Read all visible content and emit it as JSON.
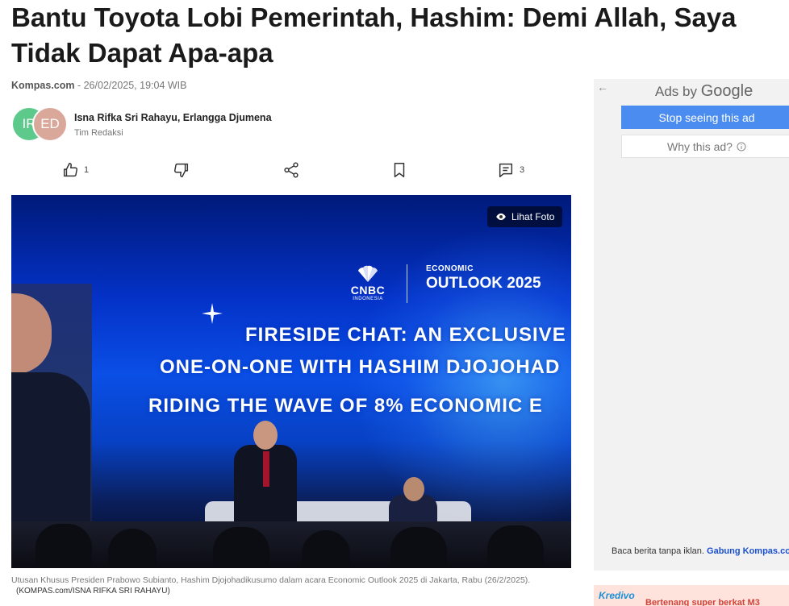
{
  "article": {
    "headline": "Bantu Toyota Lobi Pemerintah, Hashim: Demi Allah, Saya Tidak Dapat Apa-apa",
    "source": "Kompas.com",
    "separator": " - ",
    "date": "26/02/2025, 19:04 WIB",
    "authors": {
      "avatar1": "IR",
      "avatar2": "ED",
      "names": "Isna Rifka Sri Rahayu, Erlangga Djumena",
      "role": "Tim Redaksi"
    }
  },
  "actions": {
    "like_count": "1",
    "comment_count": "3"
  },
  "photo": {
    "lihat_foto": "Lihat Foto",
    "cnbc": "CNBC",
    "cnbc_sub": "INDONESIA",
    "econ_small": "ECONOMIC",
    "econ_big": "OUTLOOK 2025",
    "line1": "FIRESIDE CHAT: AN EXCLUSIVE",
    "line2": "ONE-ON-ONE WITH HASHIM DJOJOHAD",
    "line3": "RIDING THE WAVE OF 8% ECONOMIC E",
    "caption": "Utusan Khusus Presiden Prabowo Subianto, Hashim Djojohadikusumo dalam acara Economic Outlook 2025 di Jakarta, Rabu (26/2/2025).",
    "credit": "(KOMPAS.com/ISNA RIFKA SRI RAHAYU)"
  },
  "ad": {
    "back_icon": "arrow-left-icon",
    "ads_by": "Ads by ",
    "google": "Google",
    "stop": "Stop seeing this ad",
    "why": "Why this ad?",
    "noad_text": "Baca berita tanpa iklan. ",
    "noad_link": "Gabung Kompas.co",
    "kredivo_logo": "Kredivo",
    "kredivo_text": "Bertenang super berkat M3"
  },
  "colors": {
    "primary_button": "#4a8cf0",
    "link": "#1a4fd1",
    "avatar1_bg": "#5dc98a",
    "avatar2_bg": "#d9a89a"
  }
}
